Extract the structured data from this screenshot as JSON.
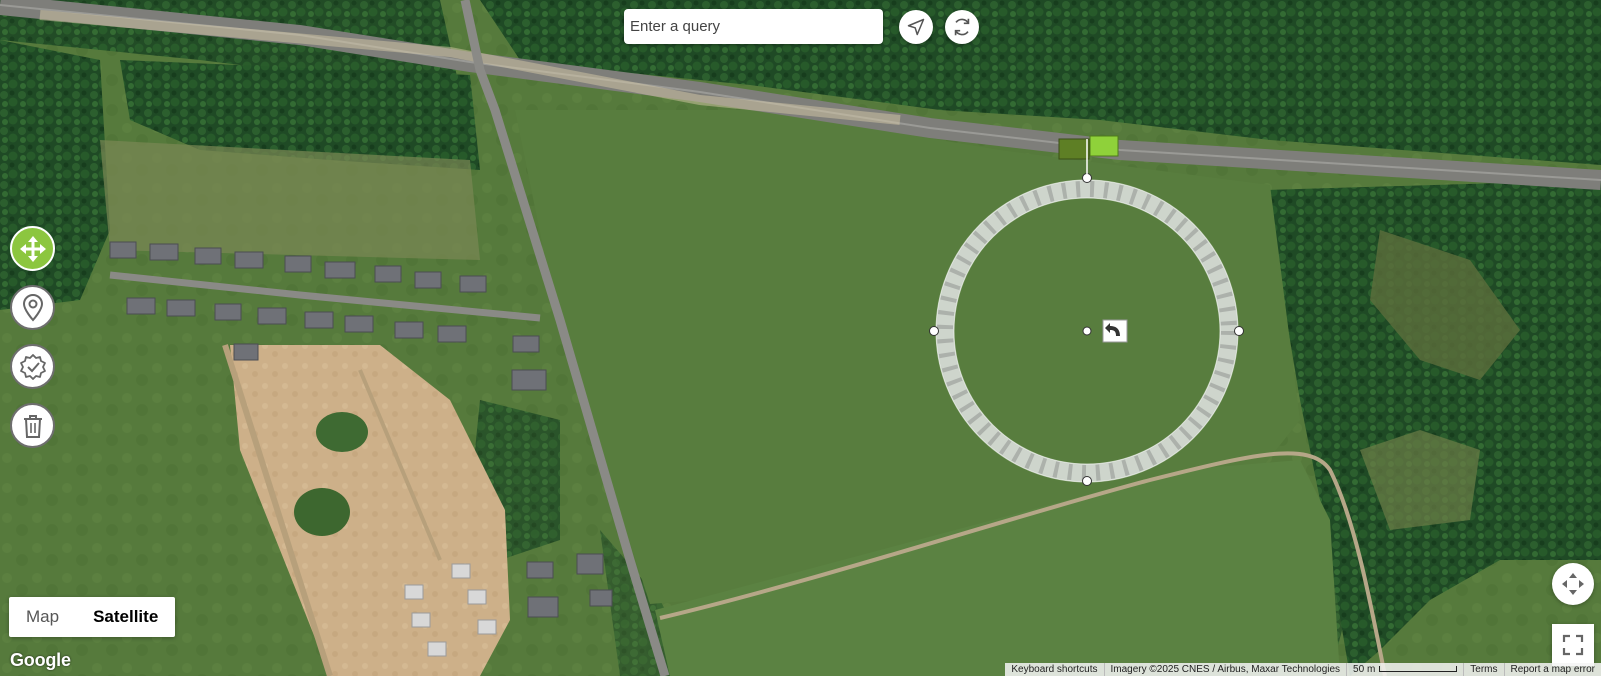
{
  "search": {
    "placeholder": "Enter a query",
    "value": ""
  },
  "top_buttons": {
    "locate_icon": "navigation-arrow-icon",
    "refresh_icon": "refresh-icon"
  },
  "tools": [
    {
      "name": "move",
      "icon": "move-arrows-icon",
      "active": true
    },
    {
      "name": "place-marker",
      "icon": "map-pin-icon",
      "active": false
    },
    {
      "name": "confirm",
      "icon": "badge-check-icon",
      "active": false
    },
    {
      "name": "delete",
      "icon": "trash-icon",
      "active": false
    }
  ],
  "map_type": {
    "map_label": "Map",
    "satellite_label": "Satellite",
    "selected": "Satellite"
  },
  "logo_text": "Google",
  "attribution": {
    "keyboard_shortcuts": "Keyboard shortcuts",
    "imagery": "Imagery ©2025 CNES / Airbus, Maxar Technologies",
    "scale": "50 m",
    "terms": "Terms",
    "report": "Report a map error"
  },
  "colors": {
    "accent_green": "#8cc63f",
    "flag_dark": "#5e7f25",
    "flag_light": "#8fd13a",
    "track_fill": "#d8dcd8"
  },
  "overlay": {
    "shape": "running track circle",
    "undo_icon": "undo-icon",
    "flag_icon": "flag-icon"
  }
}
